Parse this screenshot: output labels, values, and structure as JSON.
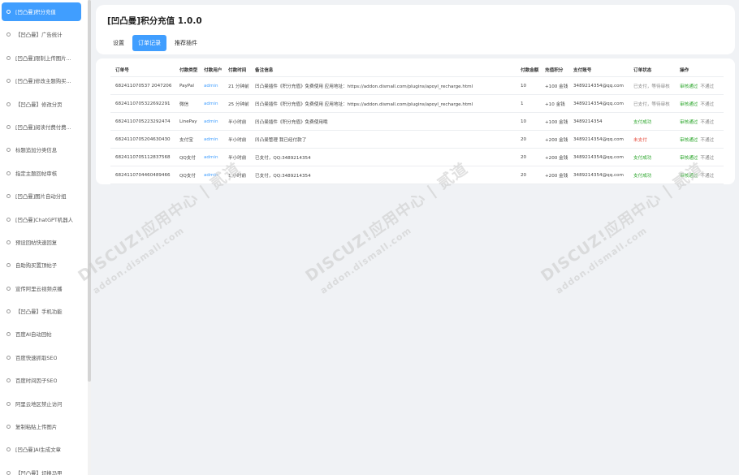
{
  "sidebar": {
    "items": [
      {
        "label": "[凹凸曼]积分充值",
        "active": true
      },
      {
        "label": "【凹凸曼】广告统计"
      },
      {
        "label": "[凹凸曼]限制上传图片..."
      },
      {
        "label": "[凹凸曼]修改主题购买..."
      },
      {
        "label": "【凹凸曼】修改分页"
      },
      {
        "label": "[凹凸曼]阅读付费付费..."
      },
      {
        "label": "标题追加分类信息"
      },
      {
        "label": "指定主题回帖审核"
      },
      {
        "label": "[凹凸曼]图片自动分组"
      },
      {
        "label": "[凹凸曼]ChatGPT机器人"
      },
      {
        "label": "预设回帖快速回复"
      },
      {
        "label": "自助购买置顶帖子"
      },
      {
        "label": "宣传阿里云视频点播"
      },
      {
        "label": "【凹凸曼】手机功能"
      },
      {
        "label": "百度AI自动回帖"
      },
      {
        "label": "百度快速抓取SEO"
      },
      {
        "label": "百度时间因子SEO"
      },
      {
        "label": "阿里云地区禁止访问"
      },
      {
        "label": "复制粘贴上传图片"
      },
      {
        "label": "[凹凸曼]AI生成文章"
      },
      {
        "label": "【凹凸曼】切换马甲"
      }
    ]
  },
  "header": {
    "title": "[凹凸曼]积分充值 1.0.0",
    "tabs": [
      {
        "label": "设置"
      },
      {
        "label": "订单记录",
        "active": true
      },
      {
        "label": "推荐插件"
      }
    ]
  },
  "table": {
    "columns": [
      "订单号",
      "付款类型",
      "付款用户",
      "付款时间",
      "备注信息",
      "付款金额",
      "充值积分",
      "支付账号",
      "订单状态",
      "操作"
    ],
    "rows": [
      {
        "order_no": "682411070537 2047206",
        "pay_type": "PayPal",
        "user": "admin",
        "time": "21 分钟前",
        "note": "凹凸曼插件《积分充值》免费使用 应用地址：https://addon.dismall.com/plugins/apoyl_recharge.html",
        "amount": "10",
        "credits": "+100 金钱",
        "account": "3489214354@qq.com",
        "status": "已支付，等待审核",
        "status_type": "gray",
        "approve": "审核通过",
        "reject": "不通过"
      },
      {
        "order_no": "6824110705322692291",
        "pay_type": "微信",
        "user": "admin",
        "time": "25 分钟前",
        "note": "凹凸曼插件《积分充值》免费使用 应用地址：https://addon.dismall.com/plugins/apoyl_recharge.html",
        "amount": "1",
        "credits": "+10 金钱",
        "account": "3489214354@qq.com",
        "status": "已支付，等待审核",
        "status_type": "gray",
        "approve": "审核通过",
        "reject": "不通过"
      },
      {
        "order_no": "6824110705223292474",
        "pay_type": "LinePay",
        "user": "admin",
        "time": "半小时前",
        "note": "凹凸曼插件《积分充值》免费使用哦",
        "amount": "10",
        "credits": "+100 金钱",
        "account": "3489214354",
        "status": "支付成功",
        "status_type": "green",
        "approve": "审核通过",
        "reject": "不通过"
      },
      {
        "order_no": "6824110705204630430",
        "pay_type": "支付宝",
        "user": "admin",
        "time": "半小时前",
        "note": "凹凸曼管理 我已经付款了",
        "amount": "20",
        "credits": "+200 金钱",
        "account": "3489214354@qq.com",
        "status": "未支付",
        "status_type": "red",
        "approve": "审核通过",
        "reject": "不通过"
      },
      {
        "order_no": "6824110705112837568",
        "pay_type": "QQ支付",
        "user": "admin",
        "time": "半小时前",
        "note": "已支付，QQ:3489214354",
        "amount": "20",
        "credits": "+200 金钱",
        "account": "3489214354@qq.com",
        "status": "支付成功",
        "status_type": "green",
        "approve": "审核通过",
        "reject": "不通过"
      },
      {
        "order_no": "6824110704460489466",
        "pay_type": "QQ支付",
        "user": "admin",
        "time": "1 小时前",
        "note": "已支付，QQ:3489214354",
        "amount": "20",
        "credits": "+200 金钱",
        "account": "3489214354@qq.com",
        "status": "支付成功",
        "status_type": "green",
        "approve": "审核通过",
        "reject": "不通过"
      }
    ]
  },
  "watermark": {
    "line1": "DISCUZ!应用中心 | 贰道",
    "line2": "addon.dismall.com"
  }
}
